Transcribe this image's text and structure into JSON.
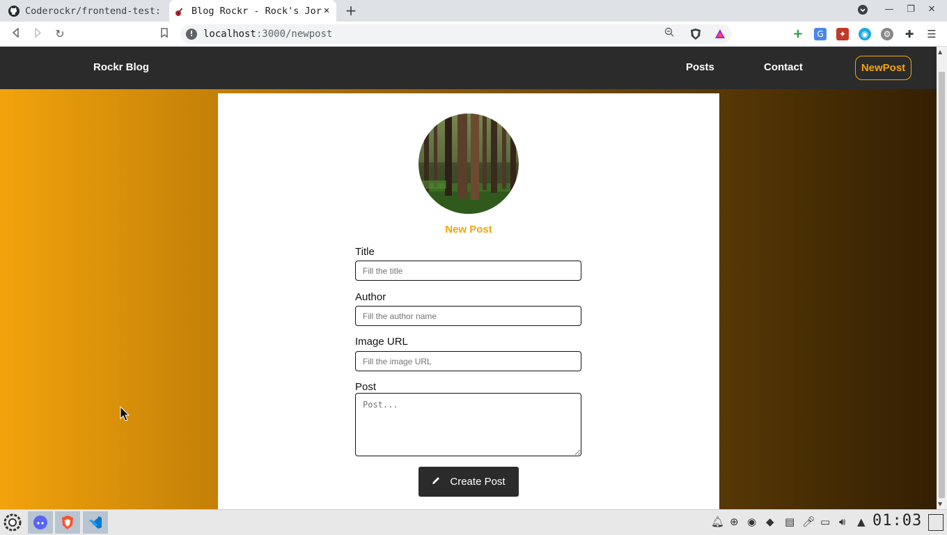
{
  "browser": {
    "tabs": [
      {
        "title": "Coderockr/frontend-test: ",
        "icon": "github-icon",
        "active": false
      },
      {
        "title": "Blog Rockr - Rock's Jor",
        "icon": "guitar-icon",
        "active": true
      }
    ],
    "address": {
      "host": "localhost",
      "path": ":3000/newpost"
    }
  },
  "nav": {
    "brand": "Rockr Blog",
    "links": [
      "Posts",
      "Contact"
    ],
    "cta": "NewPost"
  },
  "form": {
    "heading": "New Post",
    "fields": [
      {
        "label": "Title",
        "placeholder": "Fill the title"
      },
      {
        "label": "Author",
        "placeholder": "Fill the author name"
      },
      {
        "label": "Image URL",
        "placeholder": "Fill the image URL"
      }
    ],
    "post_label": "Post",
    "post_placeholder": "Post...",
    "submit": "Create Post"
  },
  "taskbar": {
    "clock": "01:03"
  },
  "colors": {
    "accent": "#f2a30c",
    "navbar": "#2b2b2b",
    "gradient_start": "#f2a30c",
    "gradient_end": "#331f02"
  }
}
